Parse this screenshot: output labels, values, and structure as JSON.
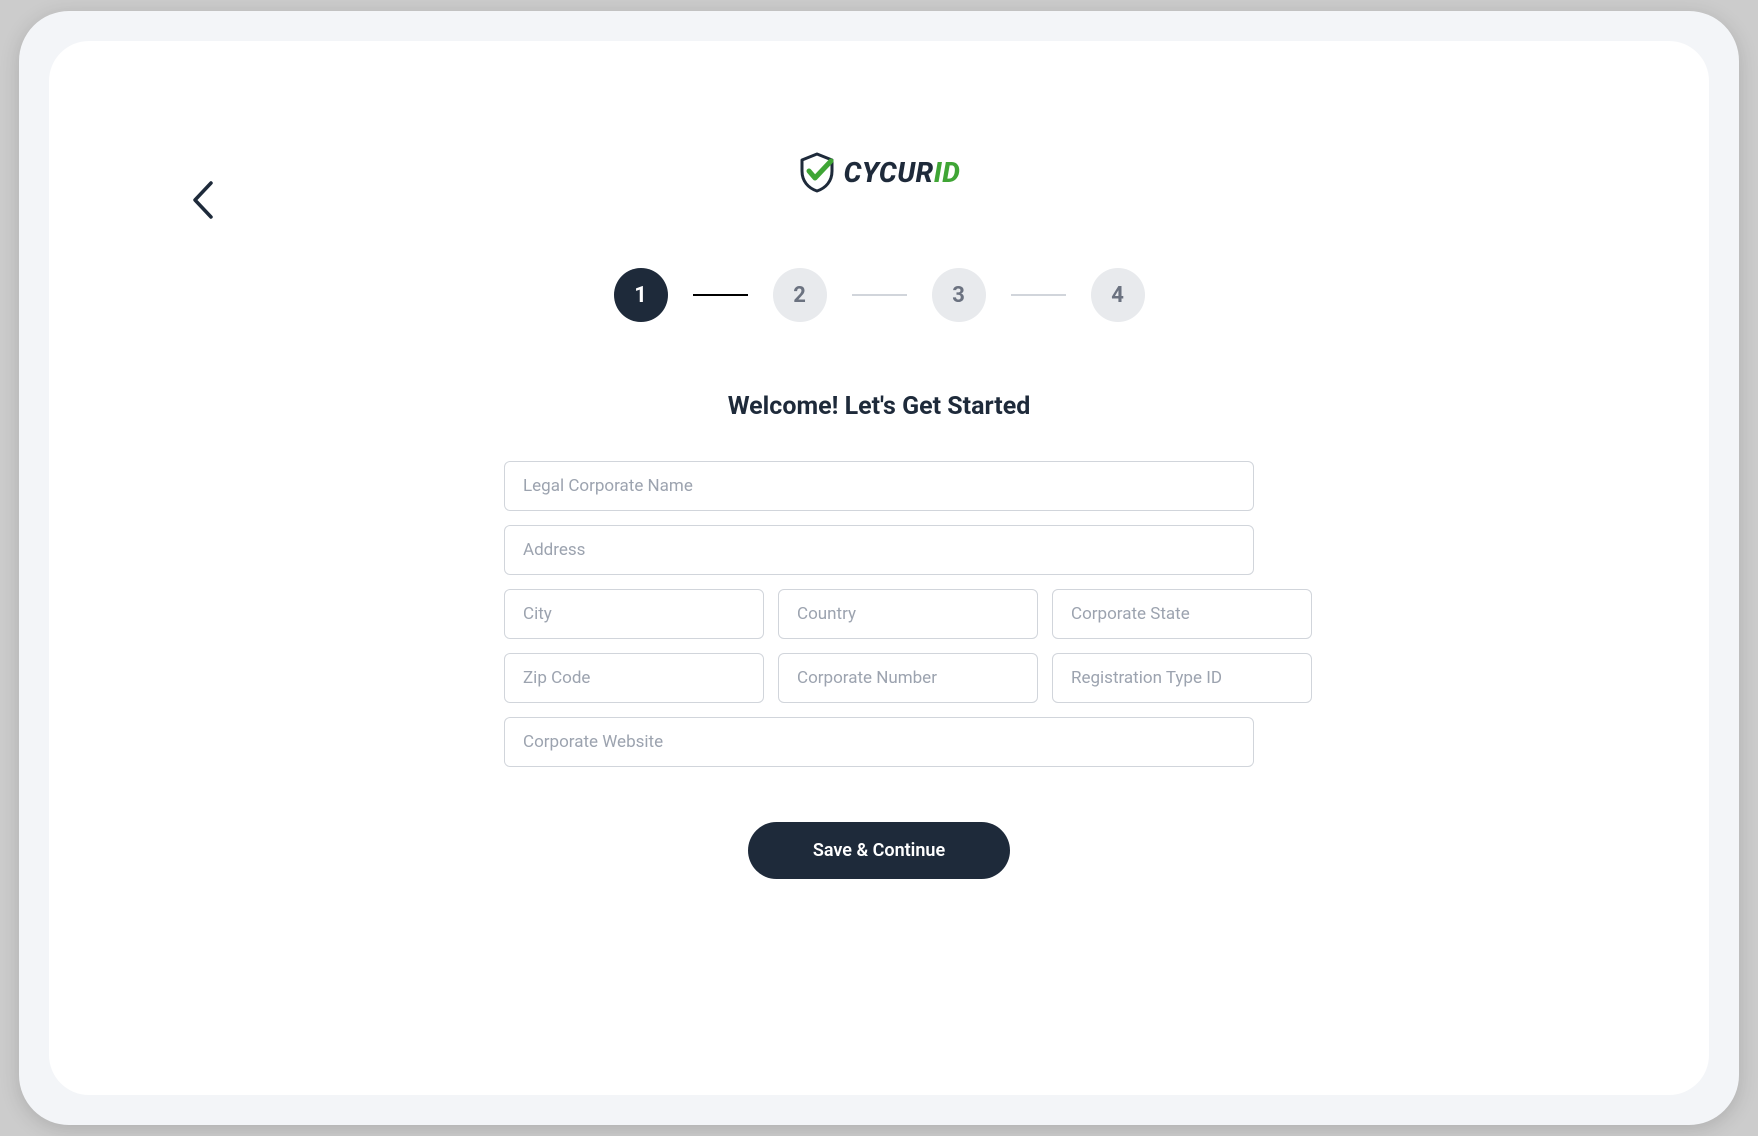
{
  "logo": {
    "text_part1": "CYCUR",
    "text_part2": "ID"
  },
  "stepper": {
    "steps": [
      "1",
      "2",
      "3",
      "4"
    ],
    "active_index": 0
  },
  "title": "Welcome! Let's Get Started",
  "form": {
    "legal_name_placeholder": "Legal Corporate Name",
    "address_placeholder": "Address",
    "city_placeholder": "City",
    "country_placeholder": "Country",
    "state_placeholder": "Corporate State",
    "zip_placeholder": "Zip Code",
    "corp_number_placeholder": "Corporate Number",
    "registration_type_placeholder": "Registration Type ID",
    "website_placeholder": "Corporate Website"
  },
  "button": {
    "save_continue_label": "Save & Continue"
  }
}
